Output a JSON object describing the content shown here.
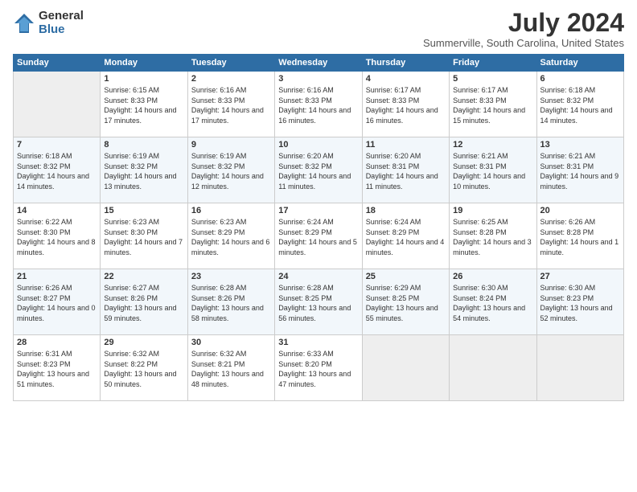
{
  "logo": {
    "general": "General",
    "blue": "Blue"
  },
  "title": "July 2024",
  "location": "Summerville, South Carolina, United States",
  "weekdays": [
    "Sunday",
    "Monday",
    "Tuesday",
    "Wednesday",
    "Thursday",
    "Friday",
    "Saturday"
  ],
  "weeks": [
    [
      {
        "day": "",
        "empty": true
      },
      {
        "day": "1",
        "sunrise": "6:15 AM",
        "sunset": "8:33 PM",
        "daylight": "14 hours and 17 minutes."
      },
      {
        "day": "2",
        "sunrise": "6:16 AM",
        "sunset": "8:33 PM",
        "daylight": "14 hours and 17 minutes."
      },
      {
        "day": "3",
        "sunrise": "6:16 AM",
        "sunset": "8:33 PM",
        "daylight": "14 hours and 16 minutes."
      },
      {
        "day": "4",
        "sunrise": "6:17 AM",
        "sunset": "8:33 PM",
        "daylight": "14 hours and 16 minutes."
      },
      {
        "day": "5",
        "sunrise": "6:17 AM",
        "sunset": "8:33 PM",
        "daylight": "14 hours and 15 minutes."
      },
      {
        "day": "6",
        "sunrise": "6:18 AM",
        "sunset": "8:32 PM",
        "daylight": "14 hours and 14 minutes."
      }
    ],
    [
      {
        "day": "7",
        "sunrise": "6:18 AM",
        "sunset": "8:32 PM",
        "daylight": "14 hours and 14 minutes."
      },
      {
        "day": "8",
        "sunrise": "6:19 AM",
        "sunset": "8:32 PM",
        "daylight": "14 hours and 13 minutes."
      },
      {
        "day": "9",
        "sunrise": "6:19 AM",
        "sunset": "8:32 PM",
        "daylight": "14 hours and 12 minutes."
      },
      {
        "day": "10",
        "sunrise": "6:20 AM",
        "sunset": "8:32 PM",
        "daylight": "14 hours and 11 minutes."
      },
      {
        "day": "11",
        "sunrise": "6:20 AM",
        "sunset": "8:31 PM",
        "daylight": "14 hours and 11 minutes."
      },
      {
        "day": "12",
        "sunrise": "6:21 AM",
        "sunset": "8:31 PM",
        "daylight": "14 hours and 10 minutes."
      },
      {
        "day": "13",
        "sunrise": "6:21 AM",
        "sunset": "8:31 PM",
        "daylight": "14 hours and 9 minutes."
      }
    ],
    [
      {
        "day": "14",
        "sunrise": "6:22 AM",
        "sunset": "8:30 PM",
        "daylight": "14 hours and 8 minutes."
      },
      {
        "day": "15",
        "sunrise": "6:23 AM",
        "sunset": "8:30 PM",
        "daylight": "14 hours and 7 minutes."
      },
      {
        "day": "16",
        "sunrise": "6:23 AM",
        "sunset": "8:29 PM",
        "daylight": "14 hours and 6 minutes."
      },
      {
        "day": "17",
        "sunrise": "6:24 AM",
        "sunset": "8:29 PM",
        "daylight": "14 hours and 5 minutes."
      },
      {
        "day": "18",
        "sunrise": "6:24 AM",
        "sunset": "8:29 PM",
        "daylight": "14 hours and 4 minutes."
      },
      {
        "day": "19",
        "sunrise": "6:25 AM",
        "sunset": "8:28 PM",
        "daylight": "14 hours and 3 minutes."
      },
      {
        "day": "20",
        "sunrise": "6:26 AM",
        "sunset": "8:28 PM",
        "daylight": "14 hours and 1 minute."
      }
    ],
    [
      {
        "day": "21",
        "sunrise": "6:26 AM",
        "sunset": "8:27 PM",
        "daylight": "14 hours and 0 minutes."
      },
      {
        "day": "22",
        "sunrise": "6:27 AM",
        "sunset": "8:26 PM",
        "daylight": "13 hours and 59 minutes."
      },
      {
        "day": "23",
        "sunrise": "6:28 AM",
        "sunset": "8:26 PM",
        "daylight": "13 hours and 58 minutes."
      },
      {
        "day": "24",
        "sunrise": "6:28 AM",
        "sunset": "8:25 PM",
        "daylight": "13 hours and 56 minutes."
      },
      {
        "day": "25",
        "sunrise": "6:29 AM",
        "sunset": "8:25 PM",
        "daylight": "13 hours and 55 minutes."
      },
      {
        "day": "26",
        "sunrise": "6:30 AM",
        "sunset": "8:24 PM",
        "daylight": "13 hours and 54 minutes."
      },
      {
        "day": "27",
        "sunrise": "6:30 AM",
        "sunset": "8:23 PM",
        "daylight": "13 hours and 52 minutes."
      }
    ],
    [
      {
        "day": "28",
        "sunrise": "6:31 AM",
        "sunset": "8:23 PM",
        "daylight": "13 hours and 51 minutes."
      },
      {
        "day": "29",
        "sunrise": "6:32 AM",
        "sunset": "8:22 PM",
        "daylight": "13 hours and 50 minutes."
      },
      {
        "day": "30",
        "sunrise": "6:32 AM",
        "sunset": "8:21 PM",
        "daylight": "13 hours and 48 minutes."
      },
      {
        "day": "31",
        "sunrise": "6:33 AM",
        "sunset": "8:20 PM",
        "daylight": "13 hours and 47 minutes."
      },
      {
        "day": "",
        "empty": true
      },
      {
        "day": "",
        "empty": true
      },
      {
        "day": "",
        "empty": true
      }
    ]
  ]
}
